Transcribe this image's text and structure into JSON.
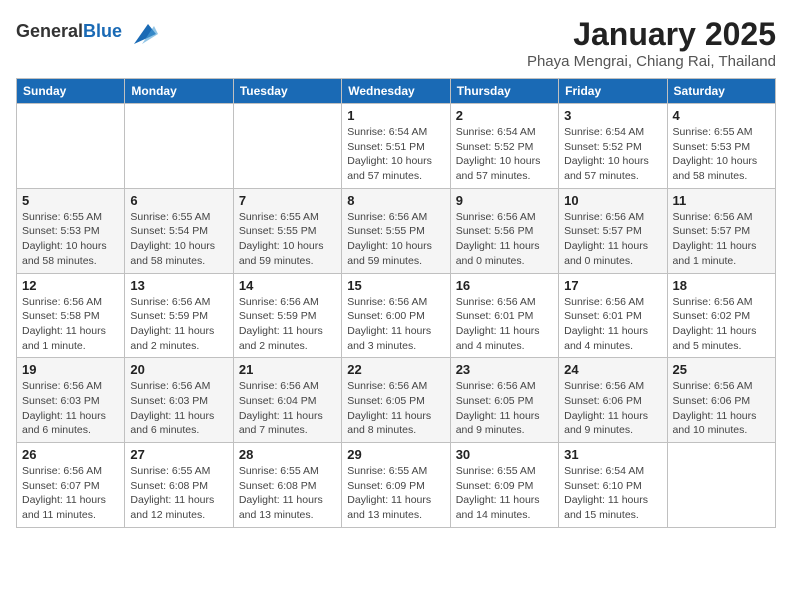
{
  "logo": {
    "general": "General",
    "blue": "Blue"
  },
  "header": {
    "month": "January 2025",
    "location": "Phaya Mengrai, Chiang Rai, Thailand"
  },
  "weekdays": [
    "Sunday",
    "Monday",
    "Tuesday",
    "Wednesday",
    "Thursday",
    "Friday",
    "Saturday"
  ],
  "weeks": [
    [
      {
        "day": "",
        "info": ""
      },
      {
        "day": "",
        "info": ""
      },
      {
        "day": "",
        "info": ""
      },
      {
        "day": "1",
        "info": "Sunrise: 6:54 AM\nSunset: 5:51 PM\nDaylight: 10 hours\nand 57 minutes."
      },
      {
        "day": "2",
        "info": "Sunrise: 6:54 AM\nSunset: 5:52 PM\nDaylight: 10 hours\nand 57 minutes."
      },
      {
        "day": "3",
        "info": "Sunrise: 6:54 AM\nSunset: 5:52 PM\nDaylight: 10 hours\nand 57 minutes."
      },
      {
        "day": "4",
        "info": "Sunrise: 6:55 AM\nSunset: 5:53 PM\nDaylight: 10 hours\nand 58 minutes."
      }
    ],
    [
      {
        "day": "5",
        "info": "Sunrise: 6:55 AM\nSunset: 5:53 PM\nDaylight: 10 hours\nand 58 minutes."
      },
      {
        "day": "6",
        "info": "Sunrise: 6:55 AM\nSunset: 5:54 PM\nDaylight: 10 hours\nand 58 minutes."
      },
      {
        "day": "7",
        "info": "Sunrise: 6:55 AM\nSunset: 5:55 PM\nDaylight: 10 hours\nand 59 minutes."
      },
      {
        "day": "8",
        "info": "Sunrise: 6:56 AM\nSunset: 5:55 PM\nDaylight: 10 hours\nand 59 minutes."
      },
      {
        "day": "9",
        "info": "Sunrise: 6:56 AM\nSunset: 5:56 PM\nDaylight: 11 hours\nand 0 minutes."
      },
      {
        "day": "10",
        "info": "Sunrise: 6:56 AM\nSunset: 5:57 PM\nDaylight: 11 hours\nand 0 minutes."
      },
      {
        "day": "11",
        "info": "Sunrise: 6:56 AM\nSunset: 5:57 PM\nDaylight: 11 hours\nand 1 minute."
      }
    ],
    [
      {
        "day": "12",
        "info": "Sunrise: 6:56 AM\nSunset: 5:58 PM\nDaylight: 11 hours\nand 1 minute."
      },
      {
        "day": "13",
        "info": "Sunrise: 6:56 AM\nSunset: 5:59 PM\nDaylight: 11 hours\nand 2 minutes."
      },
      {
        "day": "14",
        "info": "Sunrise: 6:56 AM\nSunset: 5:59 PM\nDaylight: 11 hours\nand 2 minutes."
      },
      {
        "day": "15",
        "info": "Sunrise: 6:56 AM\nSunset: 6:00 PM\nDaylight: 11 hours\nand 3 minutes."
      },
      {
        "day": "16",
        "info": "Sunrise: 6:56 AM\nSunset: 6:01 PM\nDaylight: 11 hours\nand 4 minutes."
      },
      {
        "day": "17",
        "info": "Sunrise: 6:56 AM\nSunset: 6:01 PM\nDaylight: 11 hours\nand 4 minutes."
      },
      {
        "day": "18",
        "info": "Sunrise: 6:56 AM\nSunset: 6:02 PM\nDaylight: 11 hours\nand 5 minutes."
      }
    ],
    [
      {
        "day": "19",
        "info": "Sunrise: 6:56 AM\nSunset: 6:03 PM\nDaylight: 11 hours\nand 6 minutes."
      },
      {
        "day": "20",
        "info": "Sunrise: 6:56 AM\nSunset: 6:03 PM\nDaylight: 11 hours\nand 6 minutes."
      },
      {
        "day": "21",
        "info": "Sunrise: 6:56 AM\nSunset: 6:04 PM\nDaylight: 11 hours\nand 7 minutes."
      },
      {
        "day": "22",
        "info": "Sunrise: 6:56 AM\nSunset: 6:05 PM\nDaylight: 11 hours\nand 8 minutes."
      },
      {
        "day": "23",
        "info": "Sunrise: 6:56 AM\nSunset: 6:05 PM\nDaylight: 11 hours\nand 9 minutes."
      },
      {
        "day": "24",
        "info": "Sunrise: 6:56 AM\nSunset: 6:06 PM\nDaylight: 11 hours\nand 9 minutes."
      },
      {
        "day": "25",
        "info": "Sunrise: 6:56 AM\nSunset: 6:06 PM\nDaylight: 11 hours\nand 10 minutes."
      }
    ],
    [
      {
        "day": "26",
        "info": "Sunrise: 6:56 AM\nSunset: 6:07 PM\nDaylight: 11 hours\nand 11 minutes."
      },
      {
        "day": "27",
        "info": "Sunrise: 6:55 AM\nSunset: 6:08 PM\nDaylight: 11 hours\nand 12 minutes."
      },
      {
        "day": "28",
        "info": "Sunrise: 6:55 AM\nSunset: 6:08 PM\nDaylight: 11 hours\nand 13 minutes."
      },
      {
        "day": "29",
        "info": "Sunrise: 6:55 AM\nSunset: 6:09 PM\nDaylight: 11 hours\nand 13 minutes."
      },
      {
        "day": "30",
        "info": "Sunrise: 6:55 AM\nSunset: 6:09 PM\nDaylight: 11 hours\nand 14 minutes."
      },
      {
        "day": "31",
        "info": "Sunrise: 6:54 AM\nSunset: 6:10 PM\nDaylight: 11 hours\nand 15 minutes."
      },
      {
        "day": "",
        "info": ""
      }
    ]
  ]
}
